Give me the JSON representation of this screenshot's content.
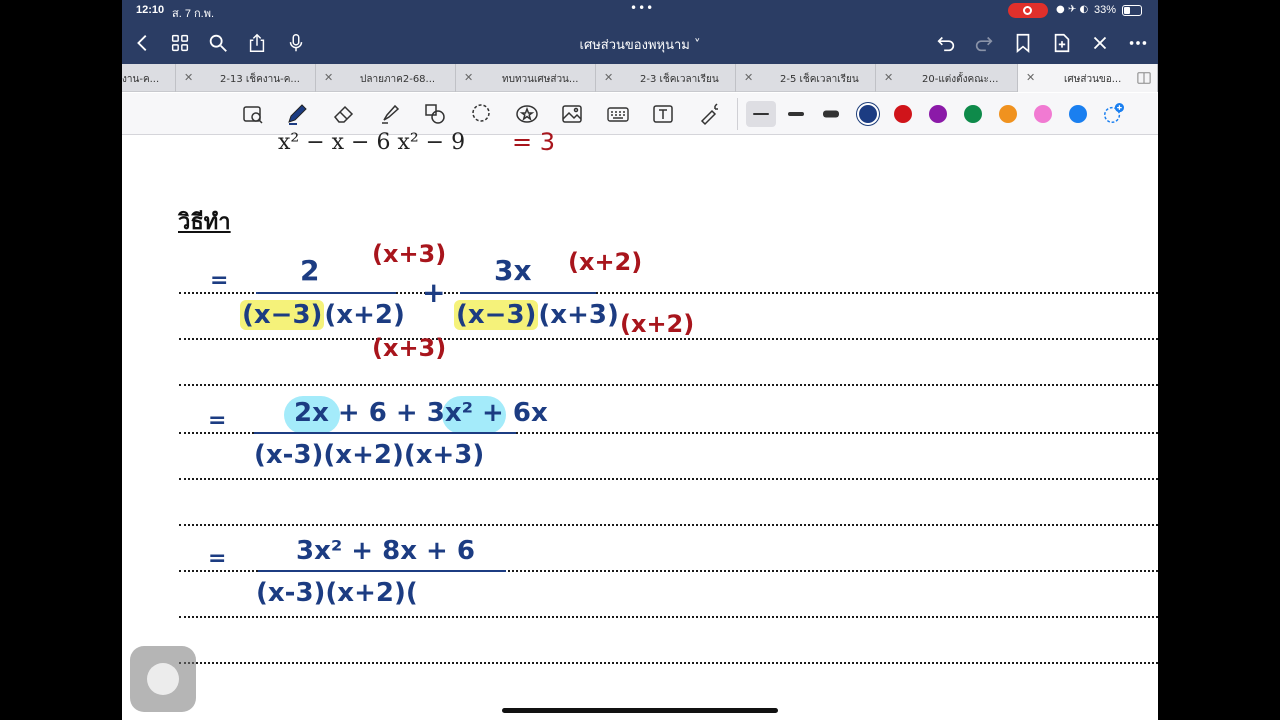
{
  "status_bar": {
    "time": "12:10",
    "date": "ส. 7 ก.พ.",
    "dots": "•••",
    "battery": "33%",
    "icons": "● ✈ ◐"
  },
  "nav": {
    "title": "เศษส่วนของพหุนาม ˅",
    "buttons": [
      "back",
      "grid",
      "search",
      "share",
      "mic",
      "undo",
      "redo",
      "bookmark",
      "add-page",
      "close",
      "more"
    ]
  },
  "tabs": [
    {
      "label": "งาน-ค..."
    },
    {
      "label": "2-13 เช็คงาน-ค..."
    },
    {
      "label": "ปลายภาค2-68..."
    },
    {
      "label": "ทบทวนเศษส่วน..."
    },
    {
      "label": "2-3 เช็คเวลาเรียน"
    },
    {
      "label": "2-5 เช็คเวลาเรียน"
    },
    {
      "label": "20-แต่งตั้งคณะ..."
    },
    {
      "label": "เศษส่วนขอ..."
    }
  ],
  "toolbar": {
    "tools": [
      "lasso-zoom",
      "pen",
      "eraser",
      "highlighter",
      "shapes",
      "lasso",
      "sticker",
      "image",
      "keyboard",
      "text",
      "laser"
    ],
    "colors": [
      "#1c3c82",
      "#d0141a",
      "#8b1aa8",
      "#0e8a4a",
      "#f0921f",
      "#f17ad2",
      "#1a7ff0"
    ],
    "selected_color": "#1c3c82"
  },
  "page": {
    "printed_top": "x² − x − 6        x² − 9",
    "printed_tail": "= 3",
    "heading": "วิธีทำ",
    "step1": {
      "eq": "=",
      "num1": "2",
      "mult1_top": "(x+3)",
      "den1_a": "(x−3)",
      "den1_b": "(x+2)",
      "mult1_bottom": "(x+3)",
      "plus": "+",
      "num2": "3x",
      "mult2_top": "(x+2)",
      "den2_a": "(x−3)",
      "den2_b": "(x+3)",
      "mult2_right": "(x+2)"
    },
    "step2": {
      "eq": "=",
      "numerator": "2x + 6 + 3x² + 6x",
      "denominator": "(x-3)(x+2)(x+3)"
    },
    "step3": {
      "eq": "=",
      "numerator": "3x² + 8x + 6",
      "denominator": "(x-3)(x+2)("
    }
  }
}
